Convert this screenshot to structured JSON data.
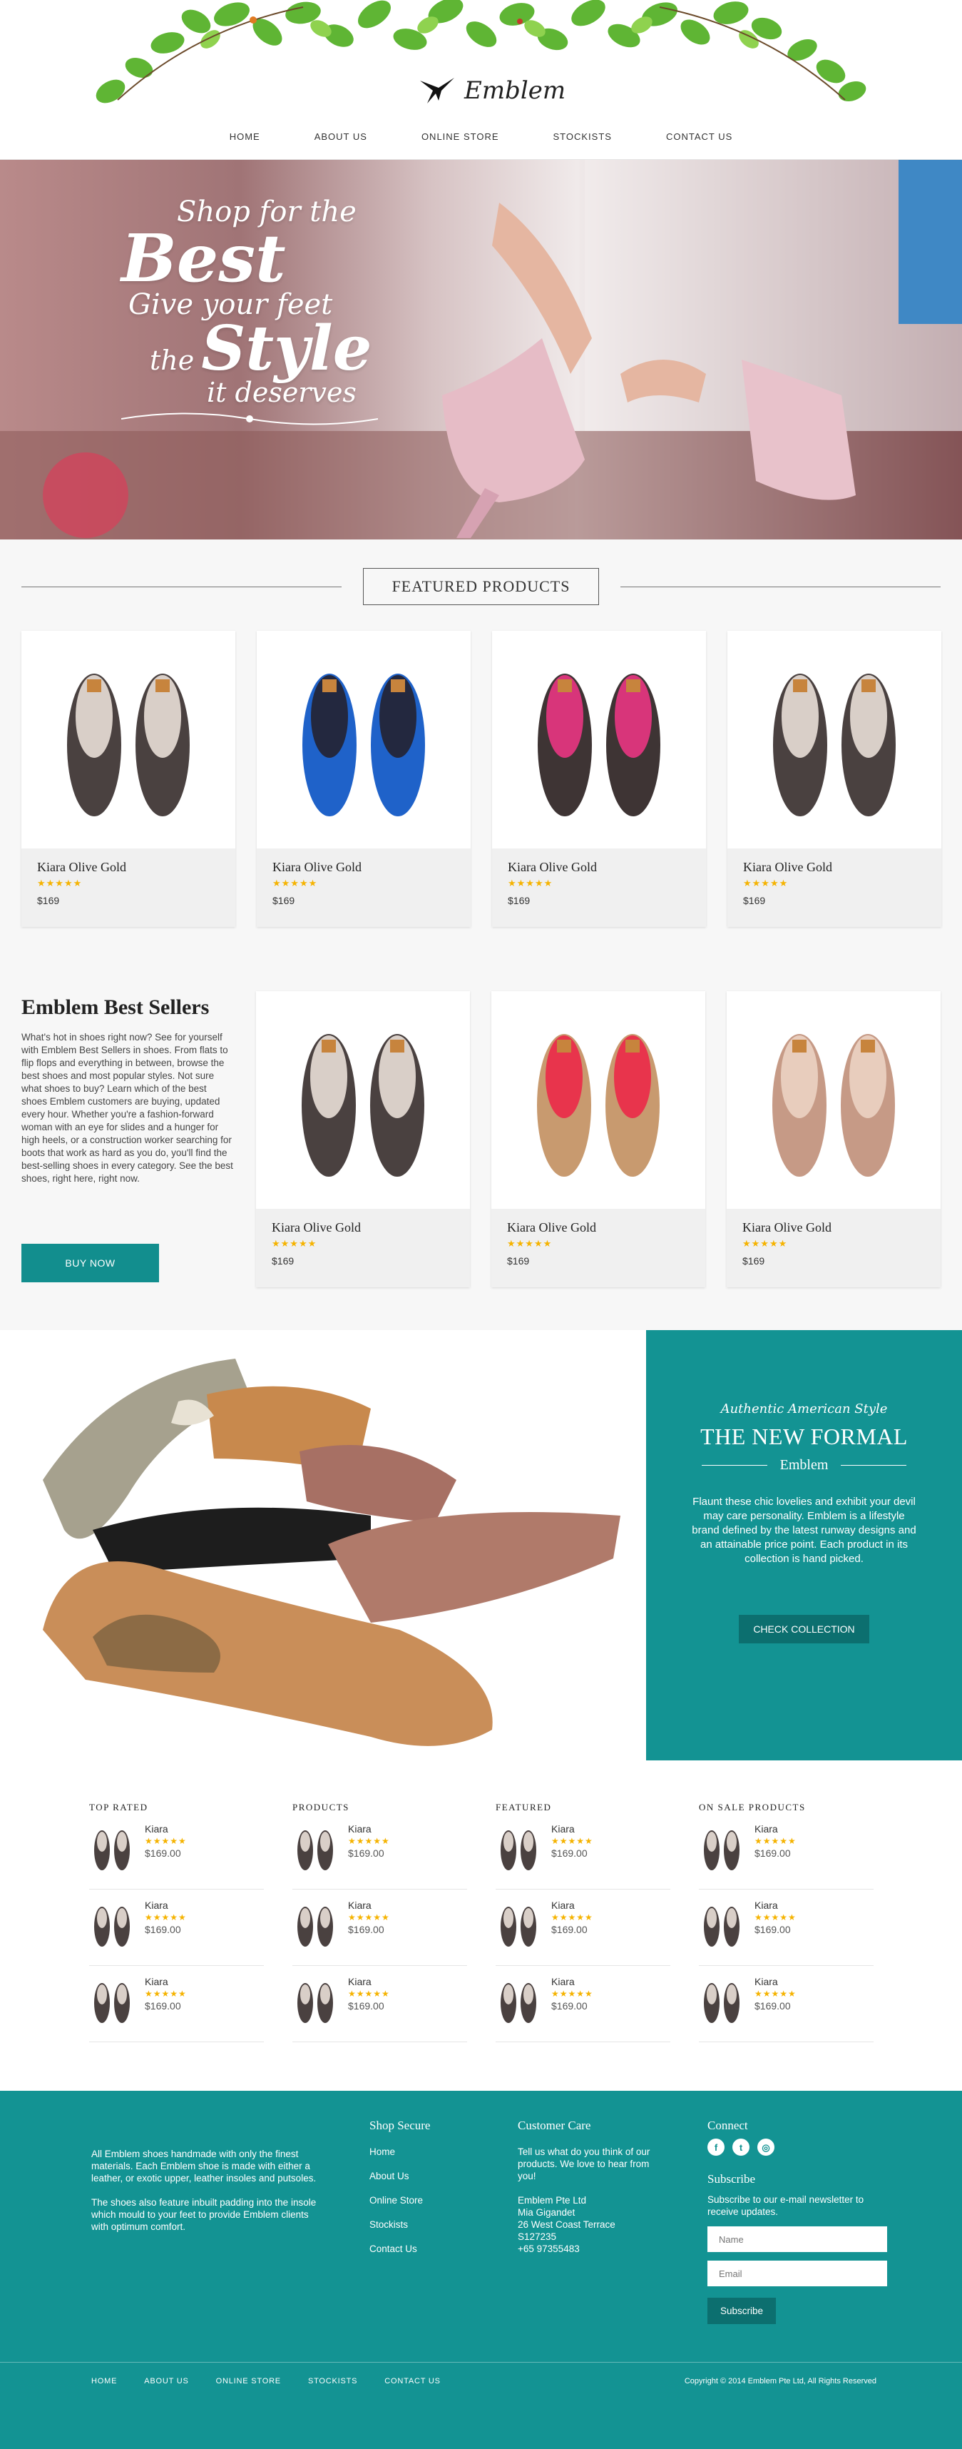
{
  "brand": {
    "name": "Emblem"
  },
  "nav": [
    {
      "label": "HOME"
    },
    {
      "label": "ABOUT US"
    },
    {
      "label": "ONLINE STORE"
    },
    {
      "label": "STOCKISTS"
    },
    {
      "label": "CONTACT US"
    }
  ],
  "hero": {
    "line1": "Shop for the",
    "line2": "Best",
    "line3": "Give your feet",
    "line4": "the",
    "line5": "Style",
    "line6": "it deserves"
  },
  "featured": {
    "title": "FEATURED PRODUCTS",
    "products": [
      {
        "name": "Kiara Olive Gold",
        "stars": "★★★★★",
        "price": "$169",
        "color": "#4a4140",
        "lining": "#d9cfc8"
      },
      {
        "name": "Kiara Olive Gold",
        "stars": "★★★★★",
        "price": "$169",
        "color": "#1f62c9",
        "lining": "#23283f"
      },
      {
        "name": "Kiara Olive Gold",
        "stars": "★★★★★",
        "price": "$169",
        "color": "#3e3434",
        "lining": "#d8357a"
      },
      {
        "name": "Kiara Olive Gold",
        "stars": "★★★★★",
        "price": "$169",
        "color": "#4a4140",
        "lining": "#d9cfc8"
      }
    ]
  },
  "bestsellers": {
    "title": "Emblem Best Sellers",
    "text": "What's hot in shoes right now? See for yourself with Emblem Best Sellers in shoes. From flats to flip flops and everything in between, browse the best shoes and most popular styles. Not sure what shoes to buy? Learn which of the best shoes Emblem customers are buying, updated every hour. Whether you're a fashion-forward woman with an eye for slides and a hunger for high heels, or a construction worker searching for boots that work as hard as you do, you'll find the best-selling shoes in every category. See the best shoes, right here, right now.",
    "button": "BUY NOW",
    "products": [
      {
        "name": "Kiara Olive Gold",
        "stars": "★★★★★",
        "price": "$169",
        "color": "#4a4140",
        "lining": "#d9cfc8"
      },
      {
        "name": "Kiara Olive Gold",
        "stars": "★★★★★",
        "price": "$169",
        "color": "#c89a6f",
        "lining": "#e8344c"
      },
      {
        "name": "Kiara Olive Gold",
        "stars": "★★★★★",
        "price": "$169",
        "color": "#c69a86",
        "lining": "#e8cdbd"
      }
    ]
  },
  "collection": {
    "tagline": "Authentic American Style",
    "title": "THE NEW FORMAL",
    "brand": "Emblem",
    "body": "Flaunt these chic lovelies and exhibit your devil may care personality. Emblem is a lifestyle brand defined by the latest runway designs and an attainable price point. Each product in its collection is hand picked.",
    "button": "CHECK COLLECTION"
  },
  "lists": [
    {
      "title": "TOP RATED",
      "items": [
        {
          "name": "Kiara",
          "stars": "★★★★★",
          "price": "$169.00"
        },
        {
          "name": "Kiara",
          "stars": "★★★★★",
          "price": "$169.00"
        },
        {
          "name": "Kiara",
          "stars": "★★★★★",
          "price": "$169.00"
        }
      ]
    },
    {
      "title": "PRODUCTS",
      "items": [
        {
          "name": "Kiara",
          "stars": "★★★★★",
          "price": "$169.00"
        },
        {
          "name": "Kiara",
          "stars": "★★★★★",
          "price": "$169.00"
        },
        {
          "name": "Kiara",
          "stars": "★★★★★",
          "price": "$169.00"
        }
      ]
    },
    {
      "title": "FEATURED",
      "items": [
        {
          "name": "Kiara",
          "stars": "★★★★★",
          "price": "$169.00"
        },
        {
          "name": "Kiara",
          "stars": "★★★★★",
          "price": "$169.00"
        },
        {
          "name": "Kiara",
          "stars": "★★★★★",
          "price": "$169.00"
        }
      ]
    },
    {
      "title": "ON SALE PRODUCTS",
      "items": [
        {
          "name": "Kiara",
          "stars": "★★★★★",
          "price": "$169.00"
        },
        {
          "name": "Kiara",
          "stars": "★★★★★",
          "price": "$169.00"
        },
        {
          "name": "Kiara",
          "stars": "★★★★★",
          "price": "$169.00"
        }
      ]
    }
  ],
  "footer": {
    "about1": "All Emblem shoes handmade with only the finest materials. Each Emblem shoe is made with either a leather, or exotic upper, leather insoles and putsoles.",
    "about2": "The shoes also feature inbuilt padding into the insole which mould to your feet to provide Emblem clients with optimum comfort.",
    "shop_title": "Shop Secure",
    "shop_links": [
      "Home",
      "About Us",
      "Online Store",
      "Stockists",
      "Contact Us"
    ],
    "care_title": "Customer Care",
    "care_text": "Tell us what do you think of our products. We love to hear from you!",
    "address": [
      "Emblem Pte Ltd",
      "Mia Gigandet",
      "26 West Coast Terrace",
      "S127235",
      "+65 97355483"
    ],
    "connect_title": "Connect",
    "subscribe_title": "Subscribe",
    "subscribe_text": "Subscribe to our e-mail newsletter to receive updates.",
    "name_placeholder": "Name",
    "email_placeholder": "Email",
    "subscribe_button": "Subscribe",
    "bottom_nav": [
      "HOME",
      "ABOUT US",
      "ONLINE STORE",
      "STOCKISTS",
      "CONTACT US"
    ],
    "copyright": "Copyright © 2014 Emblem Pte Ltd, All Rights Reserved"
  },
  "colors": {
    "teal": "#139393",
    "teal_dark": "#0c6f6f",
    "star": "#f5b301"
  }
}
